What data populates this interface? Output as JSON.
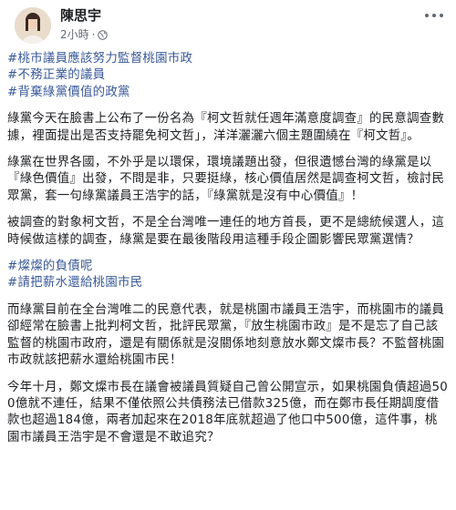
{
  "author": {
    "name": "陳思宇",
    "time": "2小時",
    "separator": "·"
  },
  "icons": {
    "avatar": "avatar-photo",
    "privacy": "globe-icon",
    "more": "more-options-icon"
  },
  "colors": {
    "hashtag": "#385898",
    "text": "#1c1e21",
    "meta": "#616770"
  },
  "post": {
    "hashtags_top": [
      "#桃市議員應該努力監督桃園市政",
      "#不務正業的議員",
      "#背棄綠黨價值的政黨"
    ],
    "paragraphs_a": [
      "綠黨今天在臉書上公布了一份名為『柯文哲就任週年滿意度調查』的民意調查數據，裡面提出是否支持罷免柯文哲」，洋洋灑灑六個主題圍繞在『柯文哲』。",
      "綠黨在世界各國，不外乎是以環保，環境議題出發，但很遺憾台灣的綠黨是以『綠色價值』出發，不問是非，只要挺綠，核心價值居然是調查柯文哲，檢討民眾黨，套一句綠黨議員王浩宇的話，『綠黨就是沒有中心價值』！",
      "被調查的對象柯文哲，不是全台灣唯一連任的地方首長，更不是總統候選人，這時候做這樣的調查，綠黨是要在最後階段用這種手段企圖影響民眾黨選情？"
    ],
    "hashtags_mid": [
      "#燦燦的負債呢",
      "#請把薪水還給桃園市民"
    ],
    "paragraphs_b": [
      "而綠黨目前在全台灣唯二的民意代表，就是桃園市議員王浩宇，而桃園市的議員卻經常在臉書上批判柯文哲，批評民眾黨，『放生桃園市政』是不是忘了自己該監督的桃園市政府，還是有關係就是沒關係地刻意放水鄭文燦市長？不監督桃園市政就該把薪水還給桃園市民！",
      "今年十月，鄭文燦市長在議會被議員質疑自己曾公開宣示，如果桃園負債超過500億就不連任，結果不僅依照公共債務法已借款325億，而在鄭市長任期調度借款也超過184億，兩者加起來在2018年底就超過了他口中500億，這件事，桃園市議員王浩宇是不會還是不敢追究？"
    ]
  }
}
